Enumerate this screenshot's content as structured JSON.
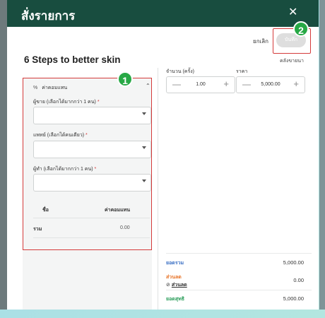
{
  "modal": {
    "title": "สั่งรายการ",
    "close_icon": "close-icon",
    "cancel_label": "ยกเลิก",
    "save_label": "บันทึก"
  },
  "annotations": {
    "badge1": "1",
    "badge2": "2"
  },
  "product": {
    "name": "6 Steps to better skin",
    "warehouse": "คลังขายนา"
  },
  "commission": {
    "header": "ค่าคอมแทน",
    "icon": "percent-icon",
    "fields": [
      {
        "label": "ผู้ขาย (เลือกได้มากกว่า 1 คน)",
        "required": "*"
      },
      {
        "label": "แพทย์ (เลือกได้คนเดียว)",
        "required": "*"
      },
      {
        "label": "ผู้ทำ (เลือกได้มากกว่า 1 คน)",
        "required": "*"
      }
    ],
    "table": {
      "col_name": "ชื่อ",
      "col_commission": "ค่าคอมแทน",
      "total_label": "รวม",
      "total_value": "0.00"
    }
  },
  "order": {
    "qty_label": "จำนวน (ครั้ง)",
    "qty_value": "1.00",
    "price_label": "ราคา",
    "price_value": "5,000.00"
  },
  "summary": {
    "total_label": "ยอดรวม",
    "total_value": "5,000.00",
    "discount_label": "ส่วนลด",
    "discount_value": "0.00",
    "discount_link": "ส่วนลด",
    "net_label": "ยอดสุทธิ",
    "net_value": "5,000.00"
  },
  "colors": {
    "header_bg": "#184d3f",
    "annotation_red": "#d43a3a",
    "badge_green": "#27a845",
    "total_blue": "#3a6fc4",
    "discount_orange": "#e8752a",
    "net_green": "#2a9d5a"
  }
}
